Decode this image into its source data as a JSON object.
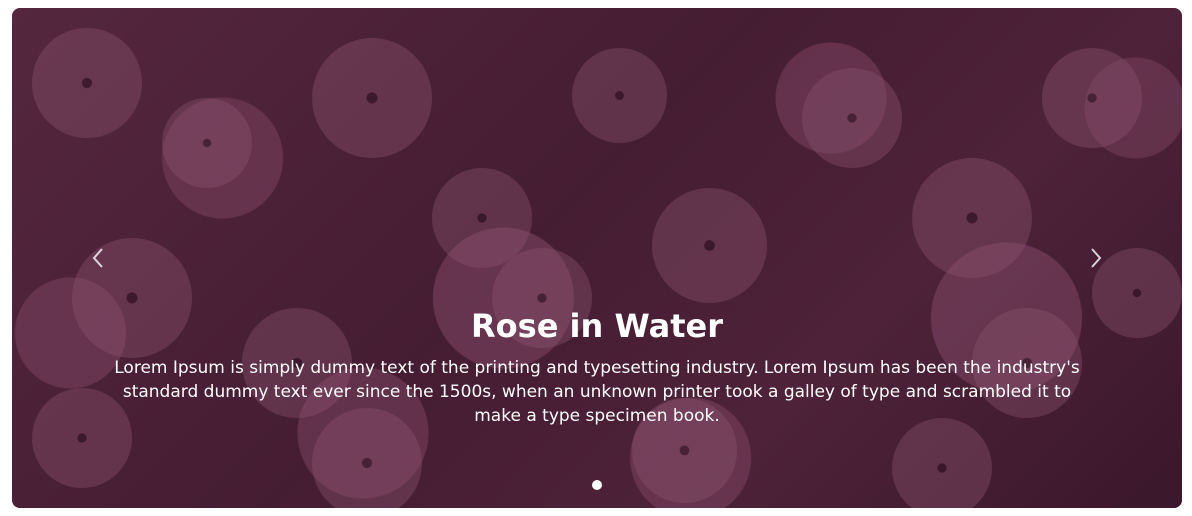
{
  "slide": {
    "title": "Rose in Water",
    "description": "Lorem Ipsum is simply dummy text of the printing and typesetting industry. Lorem Ipsum has been the industry's standard dummy text ever since the 1500s, when an unknown printer took a galley of type and scrambled it to make a type specimen book."
  },
  "controls": {
    "prev_icon": "chevron-left-icon",
    "next_icon": "chevron-right-icon"
  },
  "indicators": {
    "count": 1,
    "active_index": 0
  },
  "colors": {
    "overlay": "#280c1c",
    "flower_pink": "#d68caf",
    "text": "#ffffff"
  }
}
